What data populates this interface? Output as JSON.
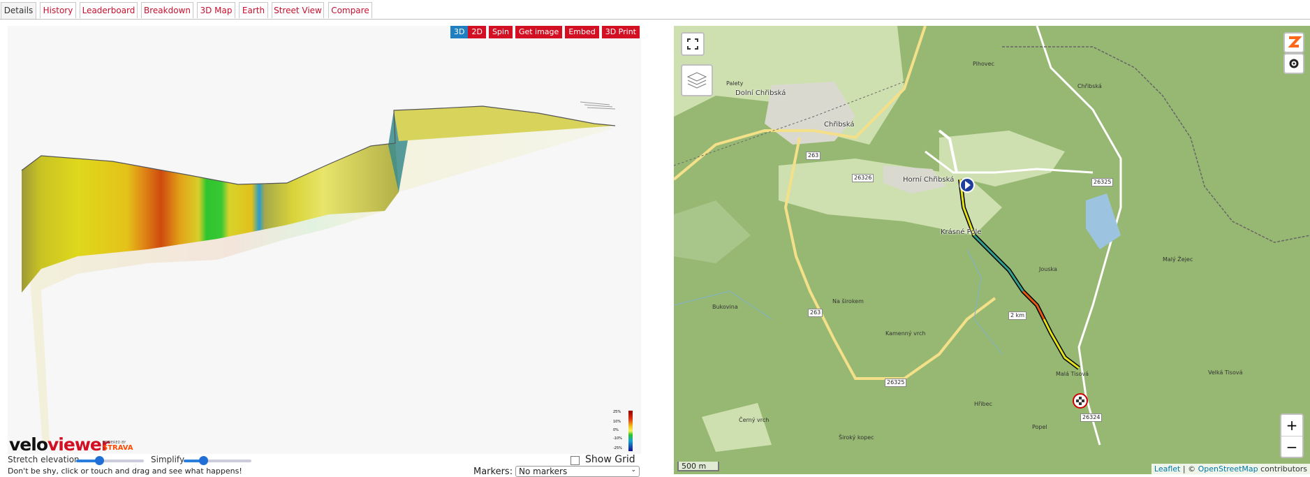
{
  "tabs": [
    {
      "label": "Details",
      "active": true
    },
    {
      "label": "History"
    },
    {
      "label": "Leaderboard"
    },
    {
      "label": "Breakdown"
    },
    {
      "label": "3D Map"
    },
    {
      "label": "Earth"
    },
    {
      "label": "Street View"
    },
    {
      "label": "Compare"
    }
  ],
  "toolbar": {
    "btn_3d": "3D",
    "btn_2d": "2D",
    "spin": "Spin",
    "get_image": "Get image",
    "embed": "Embed",
    "print": "3D Print"
  },
  "gradient_scale": {
    "labels": [
      "25%",
      "10%",
      "0%",
      "-10%",
      "-25%"
    ]
  },
  "brand": {
    "logo_a": "velo",
    "logo_b": "viewer",
    "powered": "POWERED BY",
    "strava": "STRAVA"
  },
  "controls": {
    "stretch_label": "Stretch elevation",
    "stretch_value": 0.35,
    "simplify_label": "Simplify",
    "simplify_value": 0.3,
    "show_grid_label": "Show Grid ()",
    "show_grid_checked": false,
    "hint": "Don't be shy, click or touch and drag and see what happens!",
    "markers_label": "Markers:",
    "markers_value": "No markers"
  },
  "map": {
    "zoom_in": "+",
    "zoom_out": "−",
    "scale": "500 m",
    "attribution": {
      "leaflet": "Leaflet",
      "sep": " | © ",
      "osm": "OpenStreetMap",
      "suffix": " contributors"
    },
    "places": {
      "dolni": "Dolní Chřibská",
      "chribska": "Chřibská",
      "horni": "Horní Chřibská",
      "krasne": "Krásné Pole",
      "chribska_lake": "Chřibská",
      "palety": "Palety",
      "pihovec": "Pihovec",
      "bukovina": "Bukovina",
      "na_sirokem": "Na širokem",
      "kamenny": "Kamenný vrch",
      "malyzejec": "Malý Žejec",
      "jouska": "Jouska",
      "mala_tisova": "Malá Tisová",
      "velka_tisova": "Velká Tisová",
      "hrisbec": "Hřibec",
      "cerny": "Černý vrch",
      "siroky": "Široký kopec",
      "popel": "Popel"
    },
    "roads": {
      "r263a": "263",
      "r263b": "263",
      "r26326": "26326",
      "r26325a": "26325",
      "r26325b": "26325",
      "r26324": "26324"
    },
    "km_marker": "2 km"
  }
}
